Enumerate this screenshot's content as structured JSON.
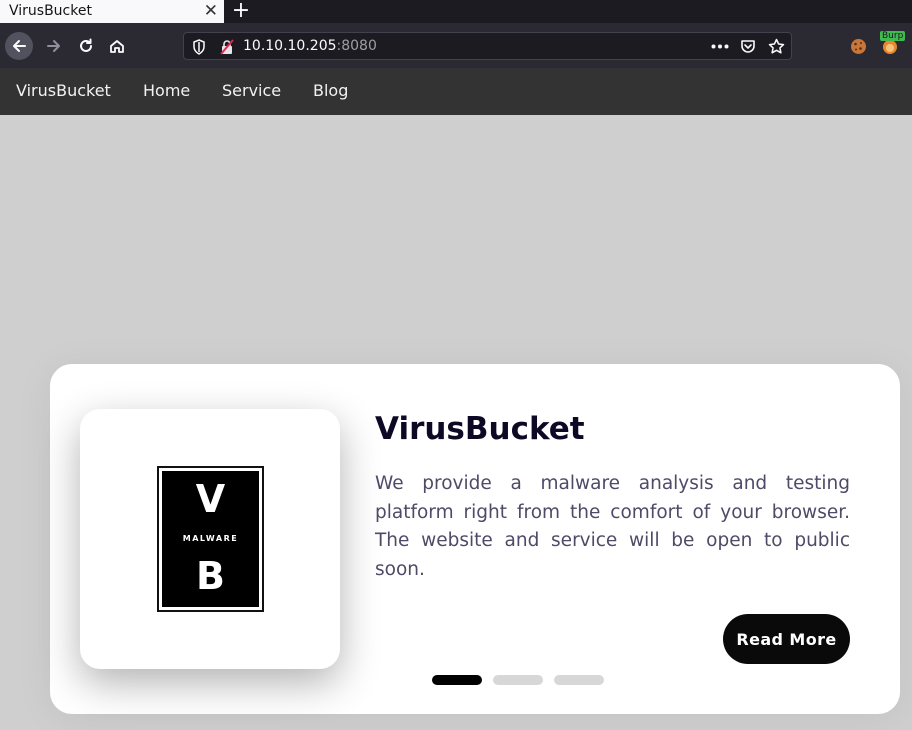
{
  "browser": {
    "tab_title": "VirusBucket",
    "tab_close": "✕",
    "new_tab": "+",
    "url_host": "10.10.10.205",
    "url_port": ":8080",
    "extension_badge": "Burp"
  },
  "site_nav": {
    "brand": "VirusBucket",
    "links": [
      "Home",
      "Service",
      "Blog"
    ]
  },
  "card": {
    "logo": {
      "top_letter": "V",
      "word": "MALWARE",
      "bottom_letter": "B"
    },
    "title": "VirusBucket",
    "description": "We provide a malware analysis and testing platform right from the comfort of your browser. The website and service will be open to public soon.",
    "button": "Read More",
    "slides_total": 3,
    "slide_active": 1
  },
  "colors": {
    "page_bg": "#cfcfcf",
    "nav_bg": "#333333",
    "title": "#0d0925",
    "text": "#4e4a67",
    "button_bg": "#0a0a0a"
  }
}
